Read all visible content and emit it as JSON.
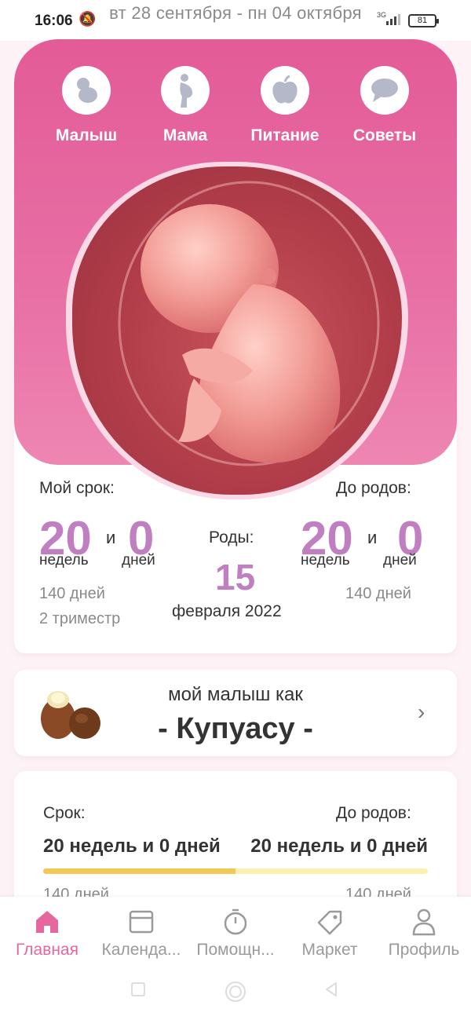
{
  "status_bar": {
    "time": "16:06",
    "date_range": "вт 28 сентября - пн 04 октября",
    "network": "3G",
    "battery": "81"
  },
  "categories": [
    {
      "label": "Малыш",
      "icon": "baby-icon"
    },
    {
      "label": "Мама",
      "icon": "pregnant-woman-icon"
    },
    {
      "label": "Питание",
      "icon": "apple-icon"
    },
    {
      "label": "Советы",
      "icon": "chat-bubble-icon"
    }
  ],
  "stats": {
    "my_term_label": "Мой срок:",
    "weeks": "20",
    "and": "и",
    "days": "0",
    "weeks_unit": "недель",
    "days_unit": "дней",
    "total_days": "140 дней",
    "trimester": "2 триместр",
    "birth_label": "Роды:",
    "birth_day": "15",
    "birth_month_year": "февраля 2022",
    "until_label": "До родов:",
    "until_weeks": "20",
    "until_days": "0",
    "until_total_days": "140 дней"
  },
  "size_card": {
    "title": "мой малыш как",
    "fruit": "- Купуасу -",
    "fruit_icon": "cupuacu-fruit-icon"
  },
  "progress_card": {
    "term_label": "Срок:",
    "term_value": "20 недель и 0 дней",
    "until_label": "До родов:",
    "until_value": "20 недель и 0 дней",
    "progress": 0.5,
    "days_left": "140 дней",
    "days_right": "140 дней"
  },
  "nav": [
    {
      "label": "Главная",
      "icon": "home-icon",
      "active": true
    },
    {
      "label": "Календа...",
      "icon": "calendar-icon",
      "active": false
    },
    {
      "label": "Помощн...",
      "icon": "timer-icon",
      "active": false
    },
    {
      "label": "Маркет",
      "icon": "tag-icon",
      "active": false
    },
    {
      "label": "Профиль",
      "icon": "profile-icon",
      "active": false
    }
  ],
  "colors": {
    "accent": "#e35b97",
    "numbers": "#c07fc0",
    "progress_fill": "#f2c957",
    "progress_track": "#fbf0b0"
  }
}
